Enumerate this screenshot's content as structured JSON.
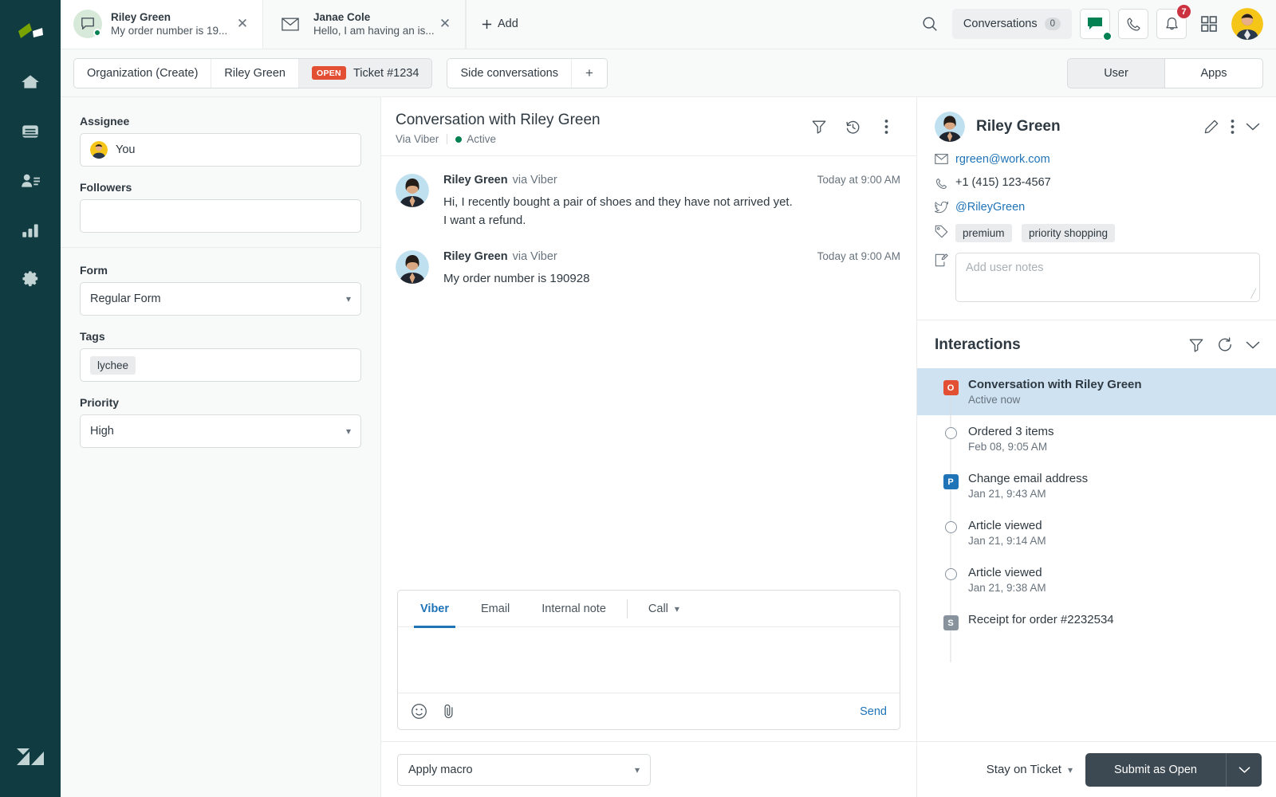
{
  "rail": {
    "logo": "product-logo",
    "items": [
      {
        "name": "home",
        "label": "Home"
      },
      {
        "name": "views",
        "label": "Views"
      },
      {
        "name": "customers",
        "label": "Customers"
      },
      {
        "name": "reporting",
        "label": "Reporting"
      },
      {
        "name": "settings",
        "label": "Settings"
      }
    ],
    "bottom_logo": "zendesk-logo"
  },
  "tabs": [
    {
      "title": "Riley Green",
      "preview": "My order number is 19...",
      "icon": "chat-bubble-icon",
      "active": true,
      "online": true
    },
    {
      "title": "Janae Cole",
      "preview": "Hello, I am having an is...",
      "icon": "envelope-icon",
      "active": false,
      "online": false
    }
  ],
  "add_tab_label": "Add",
  "toolbar": {
    "search_icon": "search-icon",
    "conversations_label": "Conversations",
    "conversations_count": "0",
    "chat_icon": "chat-icon",
    "phone_icon": "phone-icon",
    "bell_icon": "bell-icon",
    "notification_count": "7",
    "apps_grid_icon": "grid-icon",
    "avatar": "agent-avatar"
  },
  "breadcrumb": {
    "items": [
      {
        "label": "Organization (Create)",
        "badge": "",
        "selected": false
      },
      {
        "label": "Riley Green",
        "badge": "",
        "selected": false
      },
      {
        "label": "Ticket #1234",
        "badge": "OPEN",
        "selected": true
      }
    ],
    "side_conversations_label": "Side conversations",
    "add_label": "+"
  },
  "panel_toggle": {
    "options": [
      "User",
      "Apps"
    ],
    "selected": "User"
  },
  "properties": {
    "assignee": {
      "label": "Assignee",
      "value": "You"
    },
    "followers": {
      "label": "Followers",
      "value": ""
    },
    "form": {
      "label": "Form",
      "value": "Regular Form"
    },
    "tags": {
      "label": "Tags",
      "values": [
        "lychee"
      ]
    },
    "priority": {
      "label": "Priority",
      "value": "High"
    }
  },
  "conversation": {
    "title": "Conversation with Riley Green",
    "via": "Via Viber",
    "status": "Active",
    "actions": [
      "filter-icon",
      "history-icon",
      "more-vertical-icon"
    ],
    "messages": [
      {
        "author": "Riley Green",
        "via": "via Viber",
        "time": "Today at 9:00 AM",
        "text": "Hi, I recently bought a pair of shoes and they have not arrived yet. I want a refund."
      },
      {
        "author": "Riley Green",
        "via": "via Viber",
        "time": "Today at 9:00 AM",
        "text": "My order number is 190928"
      }
    ]
  },
  "composer": {
    "tabs": [
      {
        "label": "Viber",
        "active": true
      },
      {
        "label": "Email",
        "active": false
      },
      {
        "label": "Internal note",
        "active": false
      },
      {
        "label": "Call",
        "active": false,
        "has_chevron": true
      }
    ],
    "body_value": "",
    "emoji_icon": "emoji-icon",
    "attach_icon": "paperclip-icon",
    "send_label": "Send"
  },
  "footer": {
    "macro_placeholder": "Apply macro",
    "stay_label": "Stay on Ticket",
    "submit_label": "Submit as Open"
  },
  "user": {
    "name": "Riley Green",
    "avatar": "riley-avatar",
    "edit_icon": "pencil-icon",
    "more_icon": "more-vertical-icon",
    "collapse_icon": "chevron-down-icon",
    "email": "rgreen@work.com",
    "phone": "+1 (415) 123-4567",
    "twitter": "@RileyGreen",
    "tags": [
      "premium",
      "priority shopping"
    ],
    "notes_placeholder": "Add user notes"
  },
  "interactions": {
    "title": "Interactions",
    "filter_icon": "filter-icon",
    "refresh_icon": "refresh-icon",
    "collapse_icon": "chevron-down-icon",
    "items": [
      {
        "marker": "square",
        "letter": "O",
        "color": "#e34f32",
        "label": "Conversation with Riley Green",
        "time": "Active now",
        "selected": true
      },
      {
        "marker": "circle",
        "letter": "",
        "color": "",
        "label": "Ordered 3 items",
        "time": "Feb 08, 9:05 AM",
        "selected": false
      },
      {
        "marker": "square",
        "letter": "P",
        "color": "#1f73b7",
        "label": "Change email address",
        "time": "Jan 21, 9:43 AM",
        "selected": false
      },
      {
        "marker": "circle",
        "letter": "",
        "color": "",
        "label": "Article viewed",
        "time": "Jan 21, 9:14 AM",
        "selected": false
      },
      {
        "marker": "circle",
        "letter": "",
        "color": "",
        "label": "Article viewed",
        "time": "Jan 21, 9:38 AM",
        "selected": false
      },
      {
        "marker": "square",
        "letter": "S",
        "color": "#87929d",
        "label": "Receipt for order #2232534",
        "time": "",
        "selected": false
      }
    ]
  },
  "colors": {
    "rail_bg": "#0f3b41",
    "accent_blue": "#1f73b7",
    "open_badge": "#e34f32",
    "online_green": "#038153",
    "submit_dark": "#3d4952",
    "selected_row": "#cee2f2",
    "notification_red": "#cc3340"
  }
}
